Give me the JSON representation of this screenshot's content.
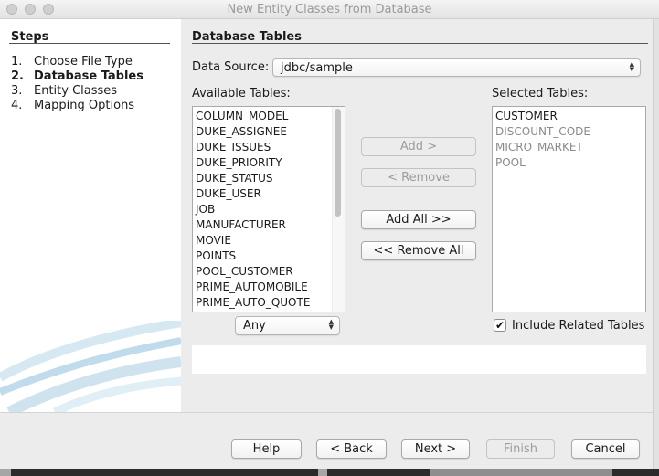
{
  "window": {
    "title": "New Entity Classes from Database"
  },
  "steps": {
    "title": "Steps",
    "items": [
      {
        "num": "1.",
        "label": "Choose File Type",
        "active": false
      },
      {
        "num": "2.",
        "label": "Database Tables",
        "active": true
      },
      {
        "num": "3.",
        "label": "Entity Classes",
        "active": false
      },
      {
        "num": "4.",
        "label": "Mapping Options",
        "active": false
      }
    ]
  },
  "main": {
    "section_title": "Database Tables",
    "data_source_label": "Data Source:",
    "data_source_value": "jdbc/sample",
    "available_label": "Available Tables:",
    "selected_label": "Selected Tables:",
    "available_tables": [
      "COLUMN_MODEL",
      "DUKE_ASSIGNEE",
      "DUKE_ISSUES",
      "DUKE_PRIORITY",
      "DUKE_STATUS",
      "DUKE_USER",
      "JOB",
      "MANUFACTURER",
      "MOVIE",
      "POINTS",
      "POOL_CUSTOMER",
      "PRIME_AUTOMOBILE",
      "PRIME_AUTO_QUOTE"
    ],
    "selected_tables": [
      {
        "name": "CUSTOMER",
        "disabled": false
      },
      {
        "name": "DISCOUNT_CODE",
        "disabled": true
      },
      {
        "name": "MICRO_MARKET",
        "disabled": true
      },
      {
        "name": "POOL",
        "disabled": true
      }
    ],
    "filter_value": "Any",
    "buttons": {
      "add": "Add >",
      "remove": "< Remove",
      "add_all": "Add All >>",
      "remove_all": "<< Remove All"
    },
    "include_related_label": "Include Related Tables",
    "include_related_checked": true
  },
  "footer": {
    "help": "Help",
    "back": "< Back",
    "next": "Next >",
    "finish": "Finish",
    "cancel": "Cancel"
  }
}
